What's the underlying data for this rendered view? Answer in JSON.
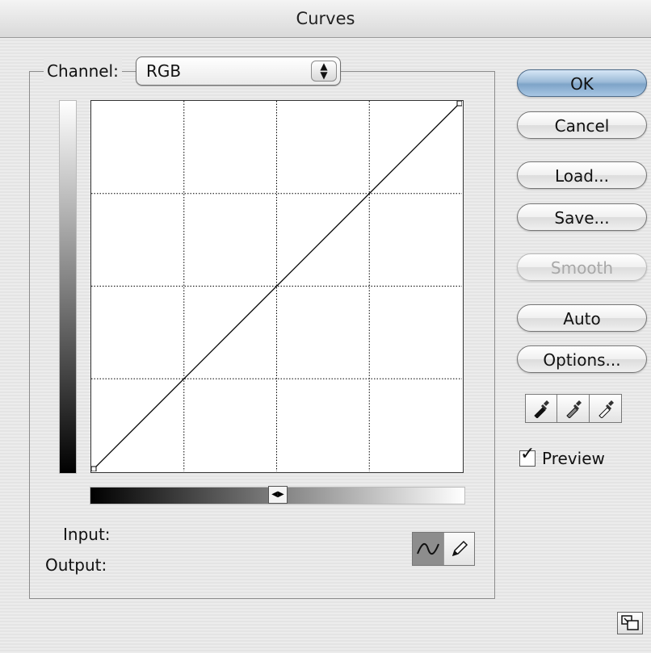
{
  "window": {
    "title": "Curves"
  },
  "channel": {
    "label": "Channel:",
    "value": "RGB"
  },
  "labels": {
    "input": "Input:",
    "output": "Output:"
  },
  "buttons": {
    "ok": "OK",
    "cancel": "Cancel",
    "load": "Load...",
    "save": "Save...",
    "smooth": "Smooth",
    "auto": "Auto",
    "options": "Options..."
  },
  "preview": {
    "label": "Preview",
    "checked": true
  },
  "curve": {
    "points": [
      [
        0,
        0
      ],
      [
        255,
        255
      ]
    ],
    "grid_divisions": 4
  },
  "tools": {
    "active": "curve-tool",
    "inactive": "pencil-tool"
  },
  "icons": [
    "stepper-icon",
    "black-eyedropper-icon",
    "gray-eyedropper-icon",
    "white-eyedropper-icon",
    "curve-tool-icon",
    "pencil-tool-icon",
    "resize-icon"
  ]
}
